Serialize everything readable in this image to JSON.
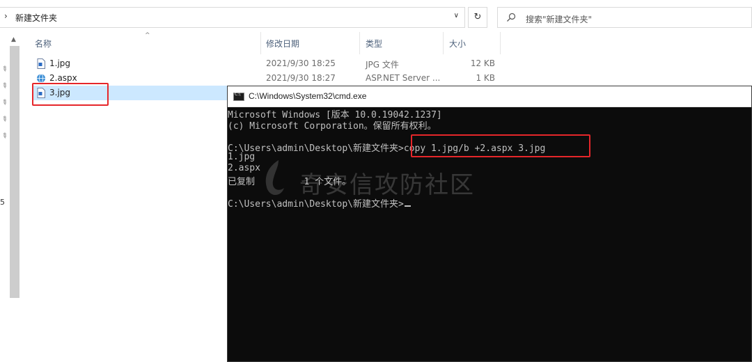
{
  "explorer": {
    "address": {
      "chevron": "›",
      "path": "新建文件夹",
      "dropdown": "∨"
    },
    "refresh": "↻",
    "search": {
      "placeholder": "搜索\"新建文件夹\""
    },
    "columns": {
      "name": "名称",
      "modified": "修改日期",
      "type": "类型",
      "size": "大小"
    },
    "files": [
      {
        "name": "1.jpg",
        "modified": "2021/9/30 18:25",
        "type": "JPG 文件",
        "size": "12 KB",
        "icon": "jpg-file-icon"
      },
      {
        "name": "2.aspx",
        "modified": "2021/9/30 18:27",
        "type": "ASP.NET Server ...",
        "size": "1 KB",
        "icon": "aspx-file-icon"
      },
      {
        "name": "3.jpg",
        "modified": "",
        "type": "",
        "size": "",
        "icon": "jpg-file-icon",
        "selected": true
      }
    ],
    "nav_fragment": "5"
  },
  "cmd": {
    "title": "C:\\Windows\\System32\\cmd.exe",
    "lines": [
      "Microsoft Windows [版本 10.0.19042.1237]",
      "(c) Microsoft Corporation。保留所有权利。",
      "",
      "C:\\Users\\admin\\Desktop\\新建文件夹>copy 1.jpg/b +2.aspx 3.jpg",
      "1.jpg",
      "2.aspx",
      "已复制         1 个文件。",
      "",
      "C:\\Users\\admin\\Desktop\\新建文件夹>"
    ],
    "watermark": "奇安信攻防社区"
  },
  "colors": {
    "highlight": "#e6262a",
    "selection": "#cce8ff",
    "console_bg": "#0c0c0c",
    "console_fg": "#c0c0c0"
  }
}
